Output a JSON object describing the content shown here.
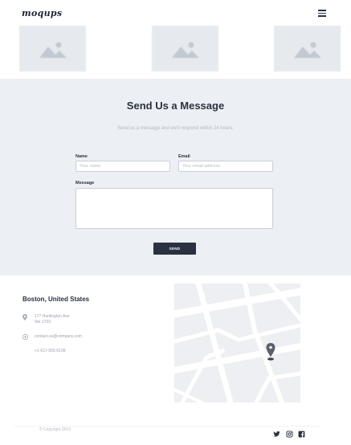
{
  "header": {
    "logo_text": "moqups",
    "menu_icon": "hamburger-menu-icon"
  },
  "gallery": {
    "image_icon": "image-placeholder-icon"
  },
  "contact": {
    "title": "Send Us a Message",
    "subtitle": "Send us a message and we'll respond within 24 hours.",
    "name_label": "Name",
    "name_placeholder": "Your name",
    "email_label": "Email",
    "email_placeholder": "Your email address",
    "message_label": "Message",
    "message_placeholder": "",
    "send_label": "SEND"
  },
  "location": {
    "title": "Boston, United States",
    "address_line1": "177 Huntington Ave",
    "address_line2": "Ste 1703",
    "email": "contact-us@company.com",
    "phone": "+1-617-555-0108",
    "address_icon": "map-pin-icon",
    "email_icon": "email-icon"
  },
  "map": {
    "marker_icon": "location-marker-icon"
  },
  "footer": {
    "copyright": "© Copyright 2019",
    "social_icons": [
      "twitter-icon",
      "instagram-icon",
      "facebook-icon"
    ]
  },
  "colors": {
    "dark": "#2a3142",
    "section_bg": "#eceff3",
    "placeholder_bg": "#e6e9ee",
    "muted_text": "#b3b9c3"
  }
}
